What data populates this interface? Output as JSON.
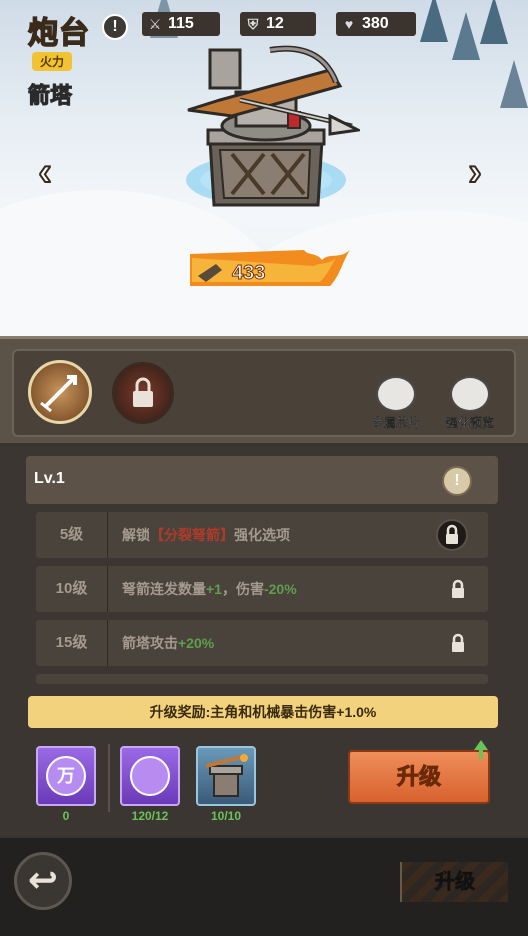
{
  "header": {
    "title": "炮台",
    "tag": "火力",
    "tower_name": "箭塔"
  },
  "power": {
    "value": "433"
  },
  "side_buttons": {
    "chips": "专属芯片",
    "preview": "强化预览"
  },
  "stats": {
    "level": "Lv.1",
    "attack": "115",
    "armor": "12",
    "hp": "380"
  },
  "upgrades": [
    {
      "level": "5级",
      "prefix": "解锁",
      "highlight": "【分裂弩箭】",
      "suffix": "强化选项"
    },
    {
      "level": "10级",
      "t1": "弩箭连发数量",
      "g1": "+1",
      "t2": "，伤害",
      "g2": "-20%"
    },
    {
      "level": "15级",
      "t1": "箭塔攻击",
      "g1": "+20%"
    }
  ],
  "reward": "升级奖励:主角和机械暴击伤害+1.0%",
  "resources": [
    {
      "icon": "万",
      "count": "0"
    },
    {
      "count": "120/12"
    },
    {
      "count": "10/10"
    }
  ],
  "upgrade_button": "升级",
  "footer": {
    "upgrade_label": "升级"
  },
  "colors": {
    "accent": "#d8612e",
    "positive": "#6ac35a",
    "highlight_red": "#b03a2a"
  }
}
